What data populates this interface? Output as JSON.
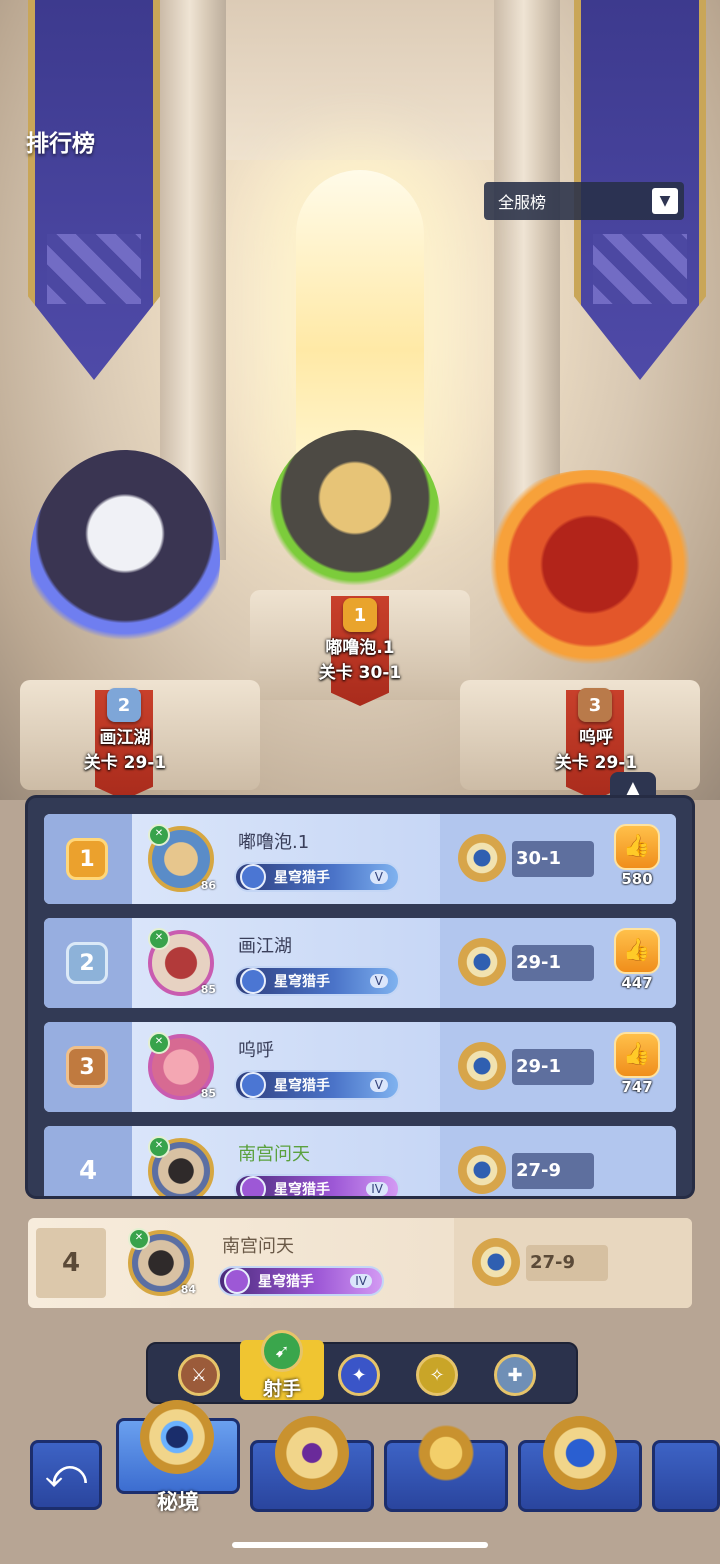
{
  "header": {
    "title": "排行榜",
    "server_filter": "全服榜"
  },
  "podium": [
    {
      "rank": "1",
      "name": "嘟噜泡.1",
      "stage": "关卡 30-1"
    },
    {
      "rank": "2",
      "name": "画江湖",
      "stage": "关卡 29-1"
    },
    {
      "rank": "3",
      "name": "呜呼",
      "stage": "关卡 29-1"
    }
  ],
  "rows": [
    {
      "rank": "1",
      "name": "嘟噜泡.1",
      "level": "86",
      "title": "星穹猎手",
      "tier": "V",
      "stage": "30-1",
      "likes": "580"
    },
    {
      "rank": "2",
      "name": "画江湖",
      "level": "85",
      "title": "星穹猎手",
      "tier": "V",
      "stage": "29-1",
      "likes": "447"
    },
    {
      "rank": "3",
      "name": "呜呼",
      "level": "85",
      "title": "星穹猎手",
      "tier": "V",
      "stage": "29-1",
      "likes": "747"
    },
    {
      "rank": "4",
      "name": "南宫问天",
      "title": "星穹猎手",
      "tier": "IV",
      "stage": "27-9"
    }
  ],
  "my_row": {
    "rank": "4",
    "name": "南宫问天",
    "level": "84",
    "title": "星穹猎手",
    "tier": "IV",
    "stage": "27-9"
  },
  "class_filter": {
    "active_label": "射手"
  },
  "bottom_tabs": {
    "active_label": "秘境"
  }
}
